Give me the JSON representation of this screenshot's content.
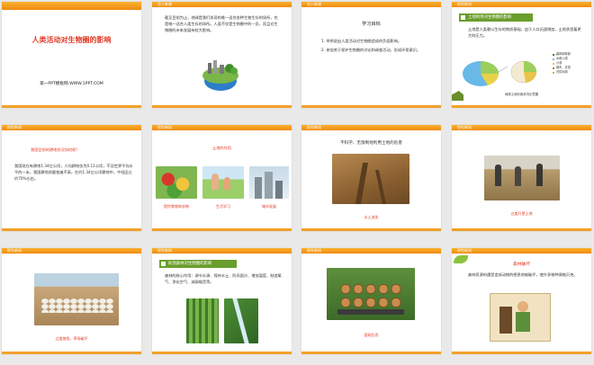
{
  "slides": [
    {
      "num": "1",
      "title": "人类活动对生物圈的影响",
      "site": "第一PPT模板网-WWW.1PPT.COM"
    },
    {
      "num": "2",
      "tag": "导入新课",
      "text": "截至目前为止，地球是我们发现的唯一适合各种生物生存的场所，也是唯一适合人类生存的场所。人类不仅是生物圈中的一员，而且对生物圈的未来发展有较大影响。"
    },
    {
      "num": "3",
      "tag": "导入新课",
      "heading": "学习目标",
      "items": [
        "1. 举例说出人类活动对生物圈造成的负面影响。",
        "2. 参加关于保护生物圈的讨论和调查活动，形成环保意识。"
      ]
    },
    {
      "num": "4",
      "tag": "探究新知",
      "section": "土地利用对生物圈的影响",
      "text": "土地是人类赖以生存的物质基础，由于人口迅速增加，土地承受着更大的压力。",
      "legend": [
        "森林和草原",
        "水和沙漠",
        "沙漠",
        "城市、农田",
        "可供利用"
      ],
      "chart_caption": "地球土地利用状况示意图"
    },
    {
      "num": "5",
      "tag": "探究新知",
      "question": "我国目前的耕地状况如何呢？",
      "text": "我国现在有耕地1.34亿公顷，人均耕地仅为0.11公顷，不及世界平均水平的一半，我国耕地质量普遍不高，在约1.34亿公顷耕地中，中低田占约70%左右。"
    },
    {
      "num": "6",
      "tag": "探究新知",
      "heading": "土地的作用",
      "captions": [
        "提供食物和衣物",
        "生活学习",
        "城市发展"
      ]
    },
    {
      "num": "7",
      "tag": "探究新知",
      "heading": "不科学、无限制地利用土地的危害",
      "caption": "水土流失"
    },
    {
      "num": "8",
      "tag": "探究新知",
      "caption": "过度开垦土地"
    },
    {
      "num": "9",
      "tag": "探究新知",
      "caption": "过度放牧，草场破坏"
    },
    {
      "num": "10",
      "tag": "探究新知",
      "section": "砍伐森林对生物圈的影响",
      "text": "森林的核心作用：调节水源、保持水土、防风固沙、增加湿度、制造氧气、净化空气、减弱噪音等。"
    },
    {
      "num": "11",
      "tag": "探究新知",
      "caption": "滥砍乱伐"
    },
    {
      "num": "12",
      "tag": "探究新知",
      "heading": "森林破坏",
      "text": "森林资源的遭受造成动物的栖息地被破坏，使许多物种濒临灭绝。"
    }
  ],
  "colors": {
    "header": "#f2a12b",
    "red": "#e23a25",
    "green": "#6a9e2d"
  }
}
